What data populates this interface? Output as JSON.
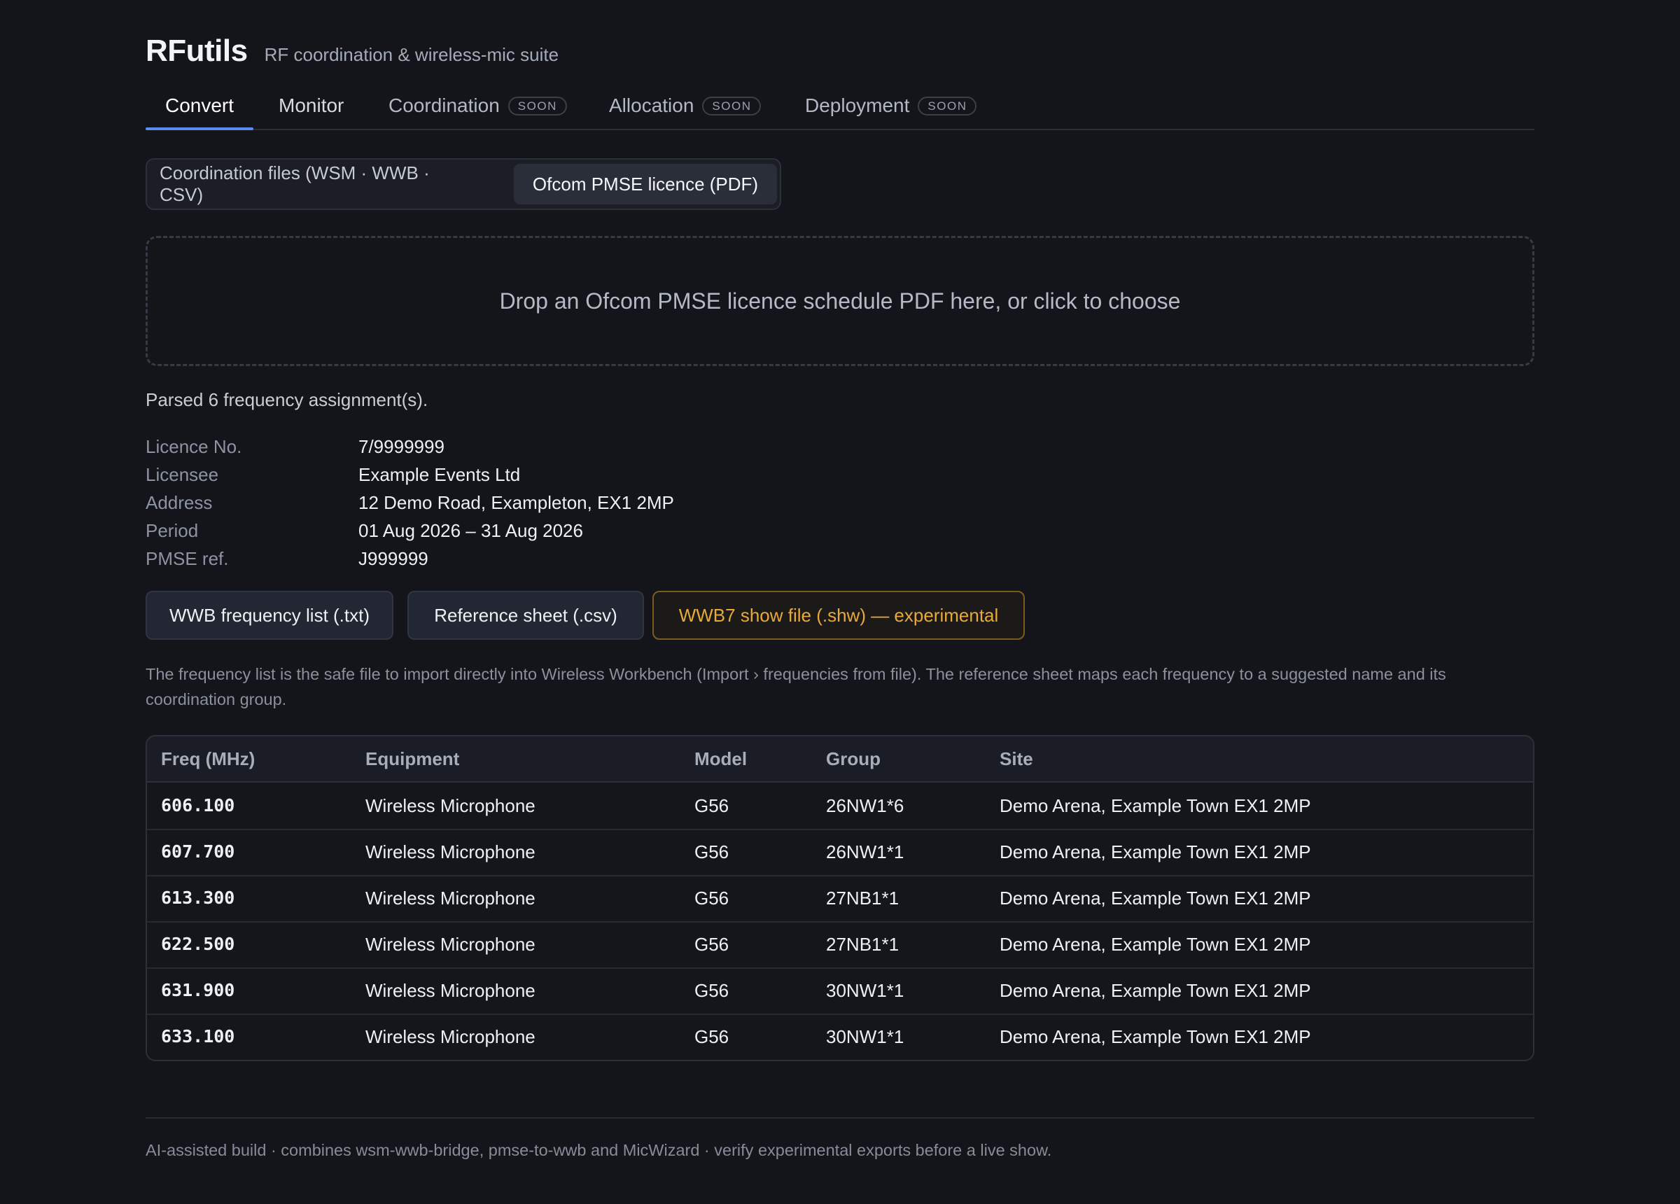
{
  "app": {
    "name": "RFutils",
    "tagline": "RF coordination & wireless-mic suite"
  },
  "tabs": [
    {
      "label": "Convert",
      "active": true,
      "badge": ""
    },
    {
      "label": "Monitor",
      "active": false,
      "badge": ""
    },
    {
      "label": "Coordination",
      "active": false,
      "badge": "SOON"
    },
    {
      "label": "Allocation",
      "active": false,
      "badge": "SOON"
    },
    {
      "label": "Deployment",
      "active": false,
      "badge": "SOON"
    }
  ],
  "source_toggle": {
    "options": [
      "Coordination files (WSM · WWB · CSV)",
      "Ofcom PMSE licence (PDF)"
    ],
    "selected": "Ofcom PMSE licence (PDF)"
  },
  "dropzone": {
    "text": "Drop an Ofcom PMSE licence schedule PDF here, or click to choose"
  },
  "status": {
    "parsed": "Parsed 6 frequency assignment(s)."
  },
  "licence": [
    {
      "label": "Licence No.",
      "value": "7/9999999"
    },
    {
      "label": "Licensee",
      "value": "Example Events Ltd"
    },
    {
      "label": "Address",
      "value": "12 Demo Road, Exampleton, EX1 2MP"
    },
    {
      "label": "Period",
      "value": "01 Aug 2026 – 31 Aug 2026"
    },
    {
      "label": "PMSE ref.",
      "value": "J999999"
    }
  ],
  "exports": {
    "wwb_txt": "WWB frequency list (.txt)",
    "ref_csv": "Reference sheet (.csv)",
    "wwb7_shw": "WWB7 show file (.shw) — experimental"
  },
  "help_text": "The frequency list is the safe file to import directly into Wireless Workbench (Import › frequencies from file). The reference sheet maps each frequency to a suggested name and its coordination group.",
  "table": {
    "headers": [
      "Freq (MHz)",
      "Equipment",
      "Model",
      "Group",
      "Site"
    ],
    "rows": [
      [
        "606.100",
        "Wireless Microphone",
        "G56",
        "26NW1*6",
        "Demo Arena, Example Town EX1 2MP"
      ],
      [
        "607.700",
        "Wireless Microphone",
        "G56",
        "26NW1*1",
        "Demo Arena, Example Town EX1 2MP"
      ],
      [
        "613.300",
        "Wireless Microphone",
        "G56",
        "27NB1*1",
        "Demo Arena, Example Town EX1 2MP"
      ],
      [
        "622.500",
        "Wireless Microphone",
        "G56",
        "27NB1*1",
        "Demo Arena, Example Town EX1 2MP"
      ],
      [
        "631.900",
        "Wireless Microphone",
        "G56",
        "30NW1*1",
        "Demo Arena, Example Town EX1 2MP"
      ],
      [
        "633.100",
        "Wireless Microphone",
        "G56",
        "30NW1*1",
        "Demo Arena, Example Town EX1 2MP"
      ]
    ]
  },
  "footer": "AI-assisted build · combines wsm-wwb-bridge, pmse-to-wwb and MicWizard · verify experimental exports before a live show.",
  "colors": {
    "background": "#13151b",
    "accent": "#5b8def",
    "warning": "#e8a93a"
  }
}
